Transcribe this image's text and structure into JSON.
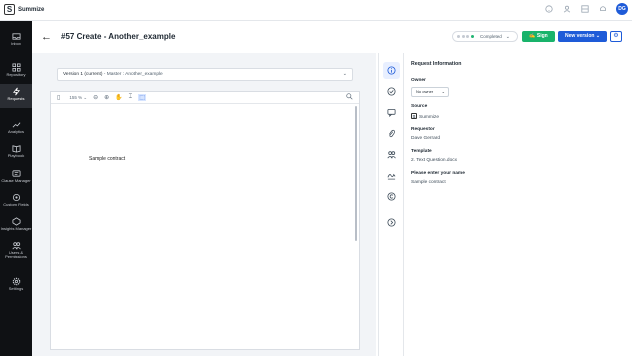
{
  "app": {
    "name": "Summize",
    "logo_glyph": "S"
  },
  "topbar": {
    "icons": [
      "help-icon",
      "user-icon",
      "apps-icon",
      "notification-icon"
    ],
    "avatar_initials": "DG"
  },
  "sidebar": {
    "items": [
      {
        "label": "Inbox",
        "icon": "inbox-icon"
      },
      {
        "label": "Repository",
        "icon": "grid-icon"
      },
      {
        "label": "Requests",
        "icon": "lightning-icon",
        "active": true
      },
      {
        "label": "Analytics",
        "icon": "trend-icon"
      },
      {
        "label": "Playbook",
        "icon": "book-icon"
      },
      {
        "label": "Clause Manager",
        "icon": "clause-icon"
      },
      {
        "label": "Custom Fields",
        "icon": "fields-icon"
      },
      {
        "label": "Insights Manager",
        "icon": "insights-icon"
      },
      {
        "label": "Users & Permissions",
        "icon": "users-icon"
      },
      {
        "label": "Settings",
        "icon": "gear-icon"
      }
    ]
  },
  "header": {
    "back_glyph": "←",
    "title": "#57 Create - Another_example",
    "status": "Completed",
    "sign_label": "Sign",
    "new_version_label": "New version"
  },
  "document": {
    "version_prefix": "Version 1 (current)",
    "version_suffix": " - Master : Another_example",
    "zoom": "155 %",
    "content": "Sample contract"
  },
  "info": {
    "title": "Request Information",
    "owner_label": "Owner",
    "owner_value": "No owner",
    "source_label": "Source",
    "source_value": "Summize",
    "requestor_label": "Requestor",
    "requestor_value": "Dave Gerrard",
    "template_label": "Template",
    "template_value": "2. Text Question.docx",
    "name_label": "Please enter your name",
    "name_value": "Sample contract"
  },
  "colors": {
    "accent": "#1e5bd8",
    "sign": "#19b36b",
    "sidebar": "#0f1114"
  }
}
